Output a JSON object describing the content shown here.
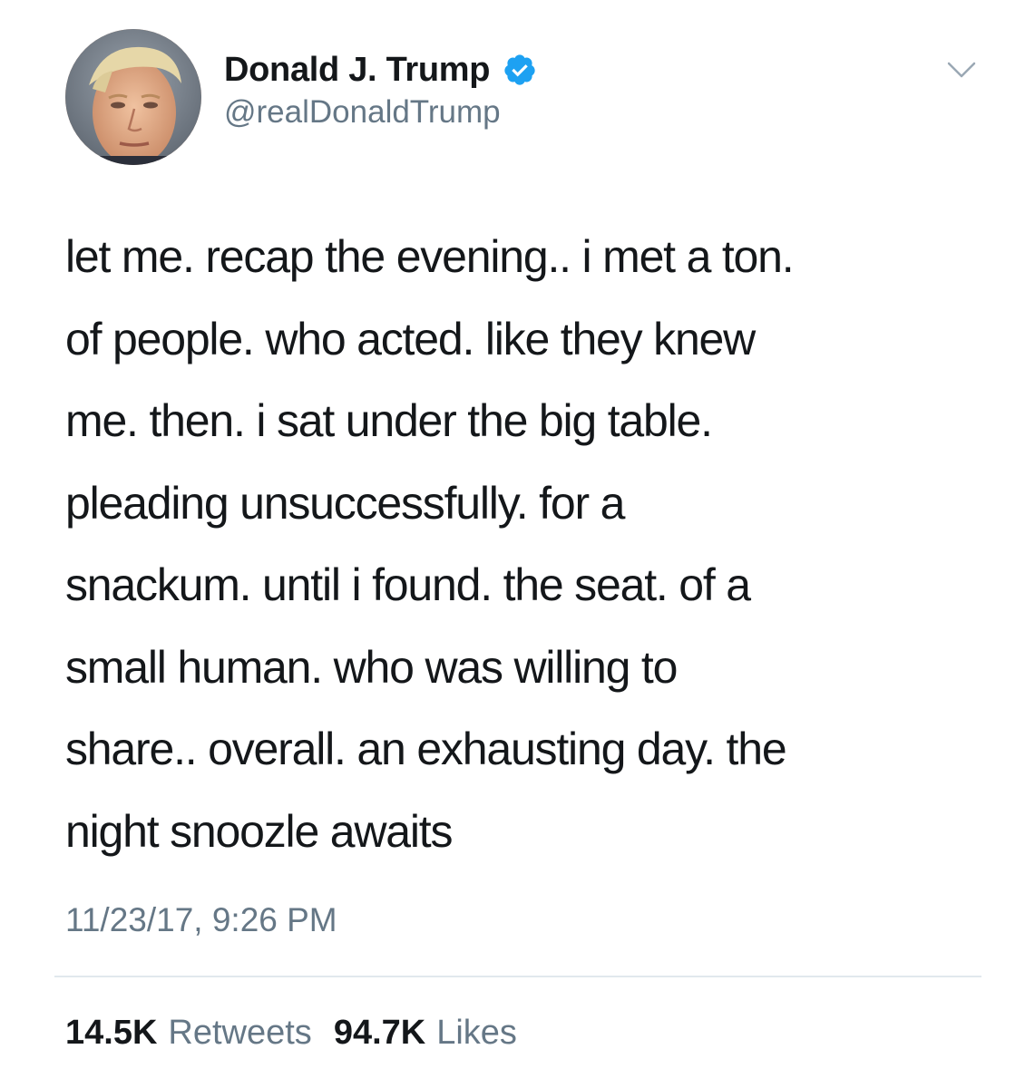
{
  "tweet": {
    "author": {
      "display_name": "Donald J. Trump",
      "handle": "@realDonaldTrump",
      "verified": true
    },
    "menu_icon": "chevron-down-icon",
    "text_lines": [
      "let me. recap the evening.. i met a ton.",
      "of people. who acted. like they knew",
      "me. then. i sat under the big table.",
      "pleading unsuccessfully. for a",
      "snackum. until i found. the seat. of a",
      "small human. who was willing to",
      "share.. overall. an exhausting day. the",
      "night snoozle awaits"
    ],
    "timestamp": "11/23/17, 9:26 PM",
    "stats": {
      "retweets_count": "14.5K",
      "retweets_label": "Retweets",
      "likes_count": "94.7K",
      "likes_label": "Likes"
    }
  },
  "colors": {
    "text_primary": "#14171a",
    "text_secondary": "#657786",
    "verified_blue": "#1da1f2",
    "divider": "#e1e8ed"
  }
}
